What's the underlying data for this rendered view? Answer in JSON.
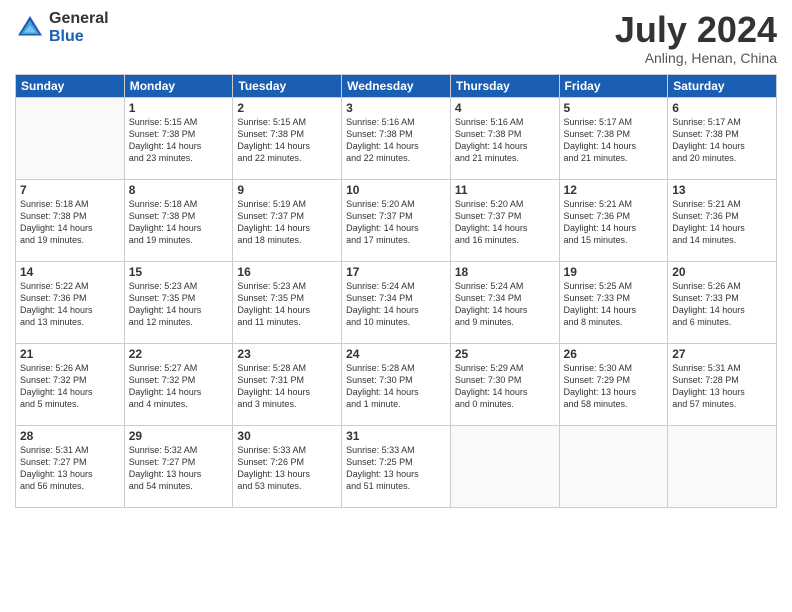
{
  "logo": {
    "general": "General",
    "blue": "Blue"
  },
  "title": "July 2024",
  "location": "Anling, Henan, China",
  "headers": [
    "Sunday",
    "Monday",
    "Tuesday",
    "Wednesday",
    "Thursday",
    "Friday",
    "Saturday"
  ],
  "weeks": [
    [
      {
        "day": "",
        "text": ""
      },
      {
        "day": "1",
        "text": "Sunrise: 5:15 AM\nSunset: 7:38 PM\nDaylight: 14 hours\nand 23 minutes."
      },
      {
        "day": "2",
        "text": "Sunrise: 5:15 AM\nSunset: 7:38 PM\nDaylight: 14 hours\nand 22 minutes."
      },
      {
        "day": "3",
        "text": "Sunrise: 5:16 AM\nSunset: 7:38 PM\nDaylight: 14 hours\nand 22 minutes."
      },
      {
        "day": "4",
        "text": "Sunrise: 5:16 AM\nSunset: 7:38 PM\nDaylight: 14 hours\nand 21 minutes."
      },
      {
        "day": "5",
        "text": "Sunrise: 5:17 AM\nSunset: 7:38 PM\nDaylight: 14 hours\nand 21 minutes."
      },
      {
        "day": "6",
        "text": "Sunrise: 5:17 AM\nSunset: 7:38 PM\nDaylight: 14 hours\nand 20 minutes."
      }
    ],
    [
      {
        "day": "7",
        "text": "Sunrise: 5:18 AM\nSunset: 7:38 PM\nDaylight: 14 hours\nand 19 minutes."
      },
      {
        "day": "8",
        "text": "Sunrise: 5:18 AM\nSunset: 7:38 PM\nDaylight: 14 hours\nand 19 minutes."
      },
      {
        "day": "9",
        "text": "Sunrise: 5:19 AM\nSunset: 7:37 PM\nDaylight: 14 hours\nand 18 minutes."
      },
      {
        "day": "10",
        "text": "Sunrise: 5:20 AM\nSunset: 7:37 PM\nDaylight: 14 hours\nand 17 minutes."
      },
      {
        "day": "11",
        "text": "Sunrise: 5:20 AM\nSunset: 7:37 PM\nDaylight: 14 hours\nand 16 minutes."
      },
      {
        "day": "12",
        "text": "Sunrise: 5:21 AM\nSunset: 7:36 PM\nDaylight: 14 hours\nand 15 minutes."
      },
      {
        "day": "13",
        "text": "Sunrise: 5:21 AM\nSunset: 7:36 PM\nDaylight: 14 hours\nand 14 minutes."
      }
    ],
    [
      {
        "day": "14",
        "text": "Sunrise: 5:22 AM\nSunset: 7:36 PM\nDaylight: 14 hours\nand 13 minutes."
      },
      {
        "day": "15",
        "text": "Sunrise: 5:23 AM\nSunset: 7:35 PM\nDaylight: 14 hours\nand 12 minutes."
      },
      {
        "day": "16",
        "text": "Sunrise: 5:23 AM\nSunset: 7:35 PM\nDaylight: 14 hours\nand 11 minutes."
      },
      {
        "day": "17",
        "text": "Sunrise: 5:24 AM\nSunset: 7:34 PM\nDaylight: 14 hours\nand 10 minutes."
      },
      {
        "day": "18",
        "text": "Sunrise: 5:24 AM\nSunset: 7:34 PM\nDaylight: 14 hours\nand 9 minutes."
      },
      {
        "day": "19",
        "text": "Sunrise: 5:25 AM\nSunset: 7:33 PM\nDaylight: 14 hours\nand 8 minutes."
      },
      {
        "day": "20",
        "text": "Sunrise: 5:26 AM\nSunset: 7:33 PM\nDaylight: 14 hours\nand 6 minutes."
      }
    ],
    [
      {
        "day": "21",
        "text": "Sunrise: 5:26 AM\nSunset: 7:32 PM\nDaylight: 14 hours\nand 5 minutes."
      },
      {
        "day": "22",
        "text": "Sunrise: 5:27 AM\nSunset: 7:32 PM\nDaylight: 14 hours\nand 4 minutes."
      },
      {
        "day": "23",
        "text": "Sunrise: 5:28 AM\nSunset: 7:31 PM\nDaylight: 14 hours\nand 3 minutes."
      },
      {
        "day": "24",
        "text": "Sunrise: 5:28 AM\nSunset: 7:30 PM\nDaylight: 14 hours\nand 1 minute."
      },
      {
        "day": "25",
        "text": "Sunrise: 5:29 AM\nSunset: 7:30 PM\nDaylight: 14 hours\nand 0 minutes."
      },
      {
        "day": "26",
        "text": "Sunrise: 5:30 AM\nSunset: 7:29 PM\nDaylight: 13 hours\nand 58 minutes."
      },
      {
        "day": "27",
        "text": "Sunrise: 5:31 AM\nSunset: 7:28 PM\nDaylight: 13 hours\nand 57 minutes."
      }
    ],
    [
      {
        "day": "28",
        "text": "Sunrise: 5:31 AM\nSunset: 7:27 PM\nDaylight: 13 hours\nand 56 minutes."
      },
      {
        "day": "29",
        "text": "Sunrise: 5:32 AM\nSunset: 7:27 PM\nDaylight: 13 hours\nand 54 minutes."
      },
      {
        "day": "30",
        "text": "Sunrise: 5:33 AM\nSunset: 7:26 PM\nDaylight: 13 hours\nand 53 minutes."
      },
      {
        "day": "31",
        "text": "Sunrise: 5:33 AM\nSunset: 7:25 PM\nDaylight: 13 hours\nand 51 minutes."
      },
      {
        "day": "",
        "text": ""
      },
      {
        "day": "",
        "text": ""
      },
      {
        "day": "",
        "text": ""
      }
    ]
  ]
}
